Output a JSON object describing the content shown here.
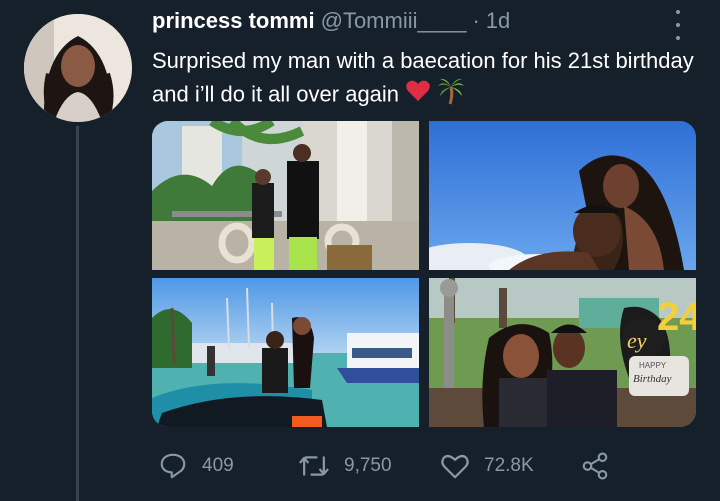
{
  "tweet": {
    "display_name": "princess tommi",
    "handle": "@Tommiii____",
    "separator": "·",
    "time": "1d",
    "text": "Surprised my man with a baecation for his 21st birthday and i’ll do it all over again",
    "emojis": [
      "heart",
      "palm-tree"
    ]
  },
  "actions": {
    "replies": "409",
    "retweets": "9,750",
    "likes": "72.8K"
  },
  "photos": {
    "p4_balloon_text": "ey",
    "p4_sign_line1": "HAPPY",
    "p4_sign_line2": "Birthday",
    "p4_balloon_number": "24"
  },
  "colors": {
    "background": "#15202b",
    "secondary_text": "#8899a6",
    "thread_line": "#38444d",
    "heart": "#e0245e"
  }
}
